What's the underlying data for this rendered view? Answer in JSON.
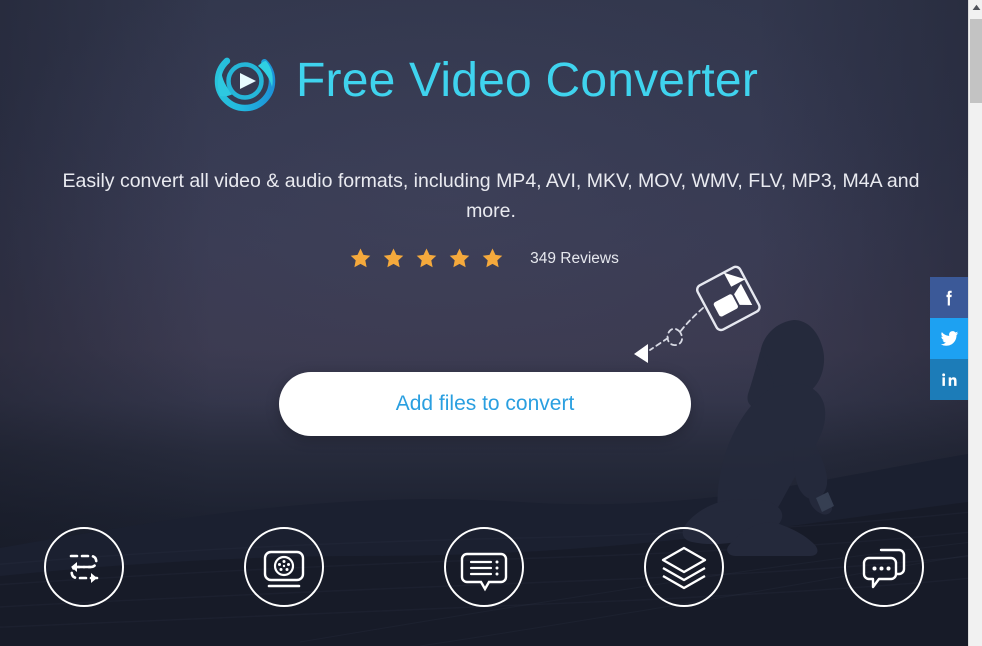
{
  "brand": {
    "logo_icon": "play-circle-swirl-icon",
    "title": "Free Video Converter",
    "title_color": "#3fd3ee"
  },
  "hero": {
    "subtitle": "Easily convert all video & audio formats, including MP4, AVI, MKV, MOV, WMV, FLV, MP3, M4A and more.",
    "cta_label": "Add files to convert",
    "cta_text_color": "#2a9fe0",
    "cta_background": "#ffffff",
    "background_top_color": "#32374d",
    "background_bottom_color": "#161a26"
  },
  "rating": {
    "stars_filled": 5,
    "star_color": "#f5a93c",
    "reviews_text": "349 Reviews"
  },
  "drop_illustration": {
    "file_icon": "video-file-icon",
    "arrow_icon": "dashed-loop-arrow-icon"
  },
  "features": [
    {
      "icon": "convert-arrows-icon",
      "name": "convert"
    },
    {
      "icon": "screen-recorder-icon",
      "name": "screen-recorder"
    },
    {
      "icon": "subtitle-bubble-icon",
      "name": "subtitle"
    },
    {
      "icon": "layers-stack-icon",
      "name": "batch-layers"
    },
    {
      "icon": "chat-bubbles-icon",
      "name": "support-chat"
    }
  ],
  "social": [
    {
      "name": "facebook",
      "icon": "facebook-icon",
      "glyph": "f",
      "color": "#3b5998"
    },
    {
      "name": "twitter",
      "icon": "twitter-icon",
      "glyph": "t",
      "color": "#1da1f2"
    },
    {
      "name": "linkedin",
      "icon": "linkedin-icon",
      "glyph": "in",
      "color": "#1c7cb8"
    }
  ],
  "scrollbar": {
    "up_arrow_icon": "scroll-up-arrow-icon",
    "thumb_color": "#c3c3c3",
    "track_color": "#f1f1f1"
  }
}
